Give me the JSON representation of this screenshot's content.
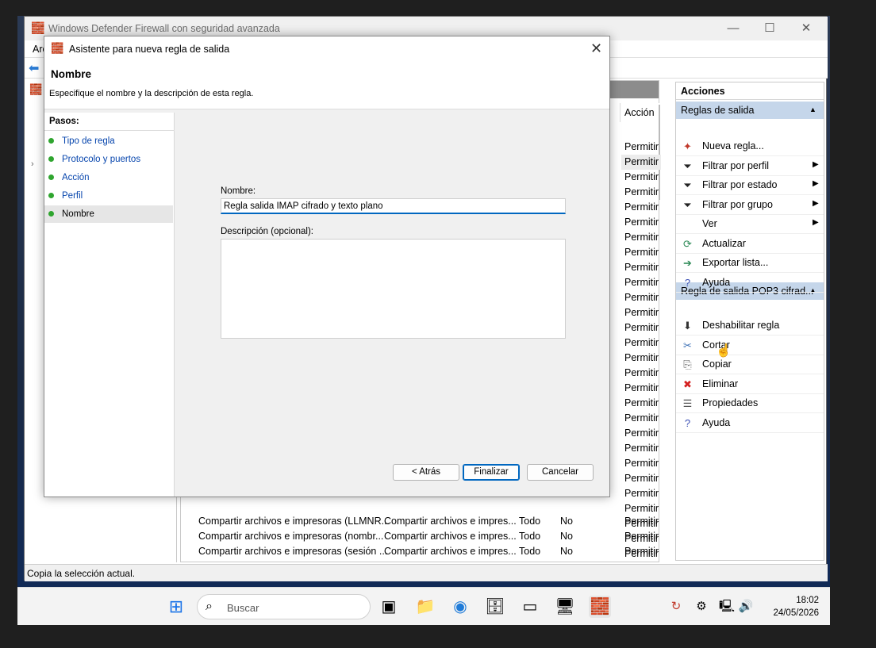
{
  "main_window": {
    "title": "Windows Defender Firewall con seguridad avanzada",
    "menu_partial": "Arc",
    "min_glyph": "—",
    "max_glyph": "☐",
    "close_glyph": "✕"
  },
  "center": {
    "column_accion": "Acción",
    "accion_values": [
      "Permitir",
      "Permitir",
      "Permitir",
      "Permitir",
      "Permitir",
      "Permitir",
      "Permitir",
      "Permitir",
      "Permitir",
      "Permitir",
      "Permitir",
      "Permitir",
      "Permitir",
      "Permitir",
      "Permitir",
      "Permitir",
      "Permitir",
      "Permitir",
      "Permitir",
      "Permitir",
      "Permitir",
      "Permitir",
      "Permitir",
      "Permitir",
      "Permitir",
      "Permitir",
      "Permitir",
      "Permitir"
    ],
    "bottom_rows": [
      {
        "name": "Compartir archivos e impresoras (LLMNR...",
        "group": "Compartir archivos e impres...",
        "profile": "Todo",
        "enabled": "No",
        "action": "Permitir"
      },
      {
        "name": "Compartir archivos e impresoras (nombr...",
        "group": "Compartir archivos e impres...",
        "profile": "Todo",
        "enabled": "No",
        "action": "Permitir"
      },
      {
        "name": "Compartir archivos e impresoras (sesión ...",
        "group": "Compartir archivos e impres...",
        "profile": "Todo",
        "enabled": "No",
        "action": "Permitir"
      }
    ]
  },
  "actions": {
    "title": "Acciones",
    "section1": "Reglas de salida",
    "items1": [
      {
        "label": "Nueva regla...",
        "icon": "new-rule-icon",
        "glyph": "✦",
        "color": "#c0392b",
        "submenu": false
      },
      {
        "label": "Filtrar por perfil",
        "icon": "filter-icon",
        "glyph": "⏷",
        "color": "#222",
        "submenu": true
      },
      {
        "label": "Filtrar por estado",
        "icon": "filter-icon",
        "glyph": "⏷",
        "color": "#222",
        "submenu": true
      },
      {
        "label": "Filtrar por grupo",
        "icon": "filter-icon",
        "glyph": "⏷",
        "color": "#222",
        "submenu": true
      },
      {
        "label": "Ver",
        "icon": "view-icon",
        "glyph": "",
        "color": "#222",
        "submenu": true
      },
      {
        "label": "Actualizar",
        "icon": "refresh-icon",
        "glyph": "⟳",
        "color": "#2e8b57",
        "submenu": false
      },
      {
        "label": "Exportar lista...",
        "icon": "export-icon",
        "glyph": "➔",
        "color": "#2e8b57",
        "submenu": false
      },
      {
        "label": "Ayuda",
        "icon": "help-icon",
        "glyph": "?",
        "color": "#3a4fb5",
        "submenu": false
      }
    ],
    "section2": "Regla de salida POP3 cifrad...",
    "items2": [
      {
        "label": "Deshabilitar regla",
        "icon": "disable-icon",
        "glyph": "⬇",
        "color": "#333"
      },
      {
        "label": "Cortar",
        "icon": "cut-icon",
        "glyph": "✂",
        "color": "#3a6fb5"
      },
      {
        "label": "Copiar",
        "icon": "copy-icon",
        "glyph": "⎘",
        "color": "#555"
      },
      {
        "label": "Eliminar",
        "icon": "delete-icon",
        "glyph": "✖",
        "color": "#d42020"
      },
      {
        "label": "Propiedades",
        "icon": "properties-icon",
        "glyph": "☰",
        "color": "#555"
      },
      {
        "label": "Ayuda",
        "icon": "help-icon",
        "glyph": "?",
        "color": "#3a4fb5"
      }
    ],
    "section_arrow": "▲",
    "submenu_arrow": "▶"
  },
  "status": "Copia la selección actual.",
  "wizard": {
    "title": "Asistente para nueva regla de salida",
    "close_glyph": "✕",
    "heading": "Nombre",
    "description": "Especifique el nombre y la descripción de esta regla.",
    "steps_title": "Pasos:",
    "steps": [
      "Tipo de regla",
      "Protocolo y puertos",
      "Acción",
      "Perfil",
      "Nombre"
    ],
    "name_label": "Nombre:",
    "name_value": "Regla salida IMAP cifrado y texto plano",
    "desc_label": "Descripción (opcional):",
    "desc_value": "",
    "back_button": "< Atrás",
    "finish_button": "Finalizar",
    "cancel_button": "Cancelar"
  },
  "taskbar": {
    "search_placeholder": "Buscar",
    "time": "18:02",
    "date": "24/05/2026"
  }
}
